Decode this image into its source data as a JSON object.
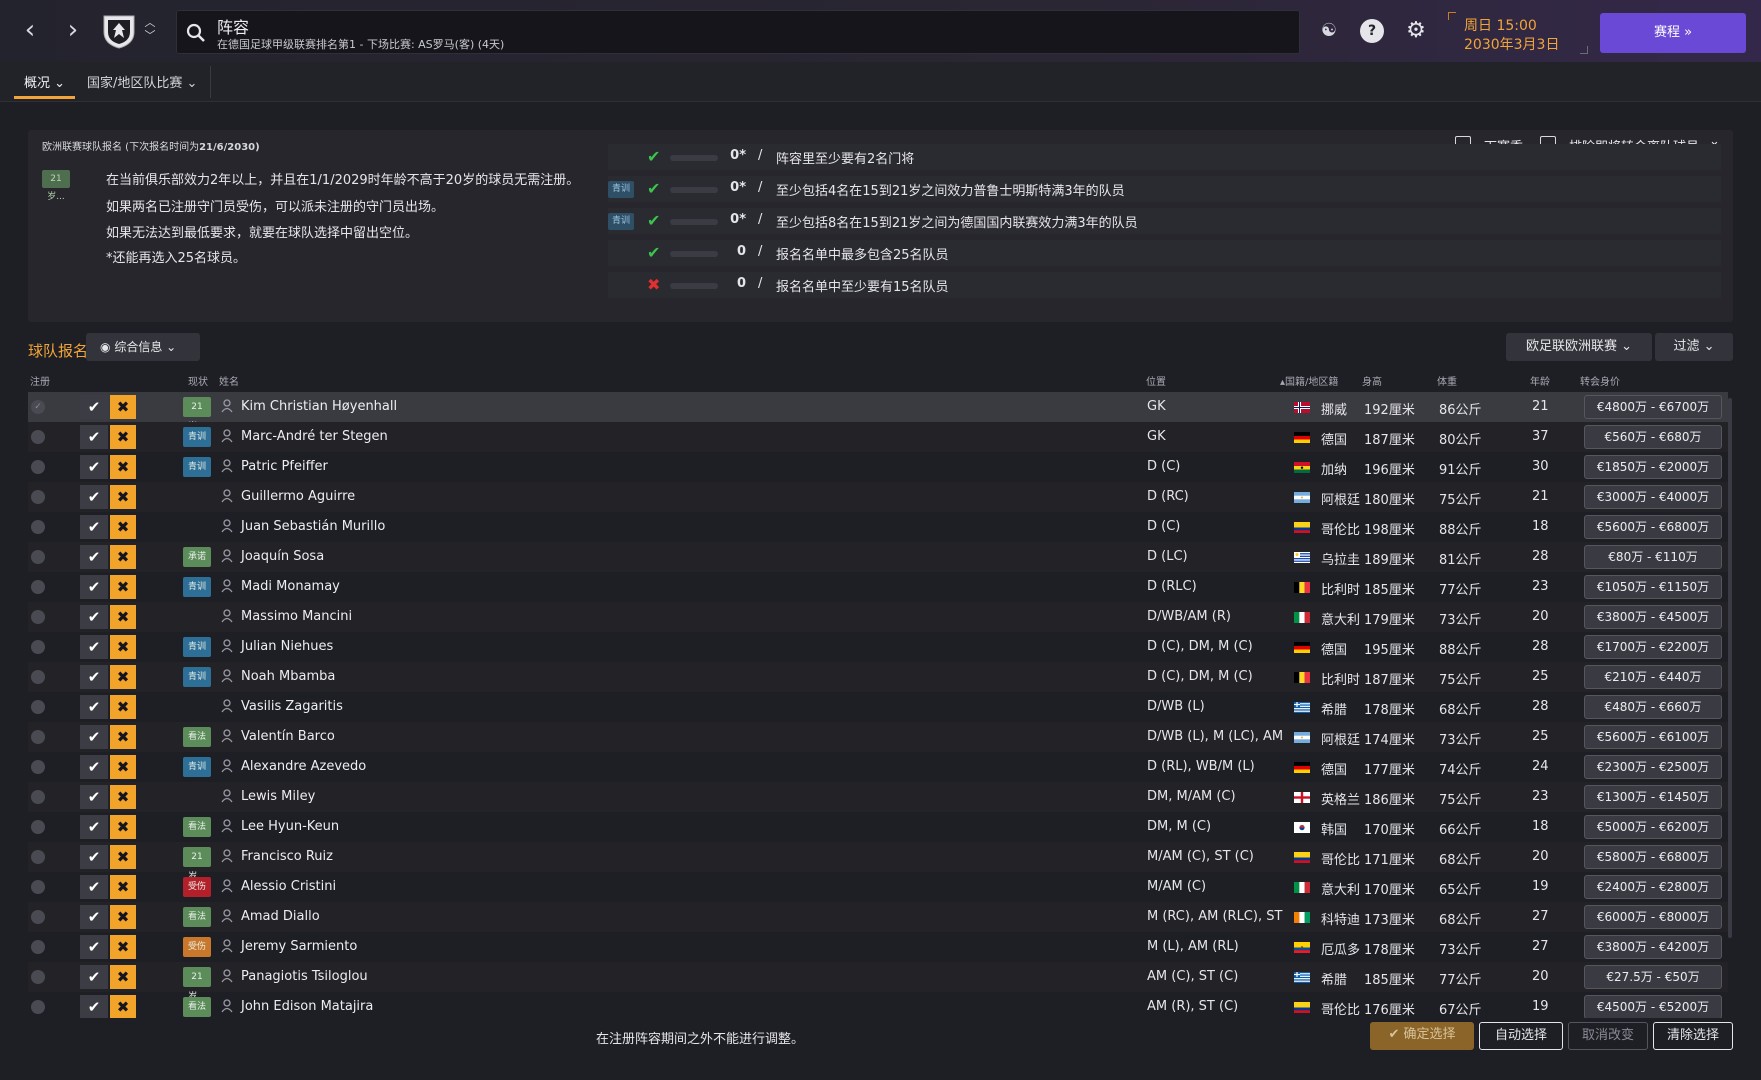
{
  "header": {
    "title": "阵容",
    "subtitle": "在德国足球甲级联赛排名第1 - 下场比赛: AS罗马(客) (4天)",
    "date_line1": "周日 15:00",
    "date_line2": "2030年3月3日",
    "continue_label": "赛程"
  },
  "subnav": {
    "tabs": [
      {
        "label": "概况"
      },
      {
        "label": "国家/地区队比赛"
      }
    ]
  },
  "registration": {
    "heading_prefix": "欧洲联赛球队报名 (下次报名时间为",
    "heading_date": "21/6/2030",
    "heading_suffix": ")",
    "next_season_label": "下赛季",
    "exclude_label": "排除即将转会离队球员",
    "age_badge": "21岁...",
    "rules": [
      "在当前俱乐部效力2年以上，并且在1/1/2029时年龄不高于20岁的球员无需注册。",
      "如果两名已注册守门员受伤，可以派未注册的守门员出场。",
      "如果无法达到最低要求，就要在球队选择中留出空位。",
      "*还能再选入25名球员。"
    ],
    "requirements": [
      {
        "ok": true,
        "badge": "",
        "value": "0*",
        "text": "阵容里至少要有2名门将"
      },
      {
        "ok": true,
        "badge": "青训",
        "value": "0*",
        "text": "至少包括4名在15到21岁之间效力普鲁士明斯特满3年的队员"
      },
      {
        "ok": true,
        "badge": "青训",
        "value": "0*",
        "text": "至少包括8名在15到21岁之间为德国国内联赛效力满3年的队员"
      },
      {
        "ok": true,
        "badge": "",
        "value": "0",
        "text": "报名名单中最多包含25名队员"
      },
      {
        "ok": false,
        "badge": "",
        "value": "0",
        "text": "报名名单中至少要有15名队员"
      }
    ]
  },
  "squad": {
    "section_title": "球队报名",
    "view_label": "综合信息",
    "competition_label": "欧足联欧洲联赛",
    "filter_label": "过滤",
    "columns": {
      "reg": "注册",
      "status": "现状",
      "name": "姓名",
      "position": "位置",
      "nation": "国籍/地区籍",
      "height": "身高",
      "weight": "体重",
      "age": "年龄",
      "value": "转会身价"
    },
    "players": [
      {
        "status": "21岁...",
        "status_color": "#5b8c5a",
        "name": "Kim Christian Høyenhall",
        "position": "GK",
        "flag": "norway",
        "nation": "挪威",
        "height": "192厘米",
        "weight": "86公斤",
        "age": "21",
        "value": "€4800万 - €6700万"
      },
      {
        "status": "青训",
        "status_color": "#2d6f96",
        "name": "Marc-André ter Stegen",
        "position": "GK",
        "flag": "germany",
        "nation": "德国",
        "height": "187厘米",
        "weight": "80公斤",
        "age": "37",
        "value": "€560万 - €680万"
      },
      {
        "status": "青训",
        "status_color": "#2d6f96",
        "name": "Patric Pfeiffer",
        "position": "D (C)",
        "flag": "ghana",
        "nation": "加纳",
        "height": "196厘米",
        "weight": "91公斤",
        "age": "30",
        "value": "€1850万 - €2000万"
      },
      {
        "status": "",
        "status_color": "",
        "name": "Guillermo Aguirre",
        "position": "D (RC)",
        "flag": "argentina",
        "nation": "阿根廷",
        "height": "180厘米",
        "weight": "75公斤",
        "age": "21",
        "value": "€3000万 - €4000万"
      },
      {
        "status": "",
        "status_color": "",
        "name": "Juan Sebastián Murillo",
        "position": "D (C)",
        "flag": "colombia",
        "nation": "哥伦比",
        "height": "198厘米",
        "weight": "88公斤",
        "age": "18",
        "value": "€5600万 - €6800万"
      },
      {
        "status": "承诺",
        "status_color": "#5b8c5a",
        "name": "Joaquín Sosa",
        "position": "D (LC)",
        "flag": "uruguay",
        "nation": "乌拉圭",
        "height": "189厘米",
        "weight": "81公斤",
        "age": "28",
        "value": "€80万 - €110万"
      },
      {
        "status": "青训",
        "status_color": "#2d6f96",
        "name": "Madi Monamay",
        "position": "D (RLC)",
        "flag": "belgium",
        "nation": "比利时",
        "height": "185厘米",
        "weight": "77公斤",
        "age": "23",
        "value": "€1050万 - €1150万"
      },
      {
        "status": "",
        "status_color": "",
        "name": "Massimo Mancini",
        "position": "D/WB/AM (R)",
        "flag": "italy",
        "nation": "意大利",
        "height": "179厘米",
        "weight": "73公斤",
        "age": "20",
        "value": "€3800万 - €4500万"
      },
      {
        "status": "青训",
        "status_color": "#2d6f96",
        "name": "Julian Niehues",
        "position": "D (C), DM, M (C)",
        "flag": "germany",
        "nation": "德国",
        "height": "195厘米",
        "weight": "88公斤",
        "age": "28",
        "value": "€1700万 - €2200万"
      },
      {
        "status": "青训",
        "status_color": "#2d6f96",
        "name": "Noah Mbamba",
        "position": "D (C), DM, M (C)",
        "flag": "belgium",
        "nation": "比利时",
        "height": "187厘米",
        "weight": "75公斤",
        "age": "25",
        "value": "€210万 - €440万"
      },
      {
        "status": "",
        "status_color": "",
        "name": "Vasilis Zagaritis",
        "position": "D/WB (L)",
        "flag": "greece",
        "nation": "希腊",
        "height": "178厘米",
        "weight": "68公斤",
        "age": "28",
        "value": "€480万 - €660万"
      },
      {
        "status": "看法",
        "status_color": "#5b8c5a",
        "name": "Valentín Barco",
        "position": "D/WB (L), M (LC), AM (...",
        "flag": "argentina",
        "nation": "阿根廷",
        "height": "174厘米",
        "weight": "73公斤",
        "age": "25",
        "value": "€5600万 - €6100万"
      },
      {
        "status": "青训",
        "status_color": "#2d6f96",
        "name": "Alexandre Azevedo",
        "position": "D (RL), WB/M (L)",
        "flag": "germany",
        "nation": "德国",
        "height": "177厘米",
        "weight": "74公斤",
        "age": "24",
        "value": "€2300万 - €2500万"
      },
      {
        "status": "",
        "status_color": "",
        "name": "Lewis Miley",
        "position": "DM, M/AM (C)",
        "flag": "england",
        "nation": "英格兰",
        "height": "186厘米",
        "weight": "75公斤",
        "age": "23",
        "value": "€1300万 - €1450万"
      },
      {
        "status": "看法",
        "status_color": "#5b8c5a",
        "name": "Lee Hyun-Keun",
        "position": "DM, M (C)",
        "flag": "korea",
        "nation": "韩国",
        "height": "170厘米",
        "weight": "66公斤",
        "age": "18",
        "value": "€5000万 - €6200万"
      },
      {
        "status": "21岁...",
        "status_color": "#5b8c5a",
        "name": "Francisco Ruiz",
        "position": "M/AM (C), ST (C)",
        "flag": "colombia",
        "nation": "哥伦比",
        "height": "171厘米",
        "weight": "68公斤",
        "age": "20",
        "value": "€5800万 - €6800万"
      },
      {
        "status": "受伤",
        "status_color": "#b3202a",
        "name": "Alessio Cristini",
        "position": "M/AM (C)",
        "flag": "italy",
        "nation": "意大利",
        "height": "170厘米",
        "weight": "65公斤",
        "age": "19",
        "value": "€2400万 - €2800万"
      },
      {
        "status": "看法",
        "status_color": "#5b8c5a",
        "name": "Amad Diallo",
        "position": "M (RC), AM (RLC), ST (...",
        "flag": "ivorycoast",
        "nation": "科特迪",
        "height": "173厘米",
        "weight": "68公斤",
        "age": "27",
        "value": "€6000万 - €8000万"
      },
      {
        "status": "受伤",
        "status_color": "#c9772a",
        "name": "Jeremy Sarmiento",
        "position": "M (L), AM (RL)",
        "flag": "ecuador",
        "nation": "厄瓜多",
        "height": "178厘米",
        "weight": "73公斤",
        "age": "27",
        "value": "€3800万 - €4200万"
      },
      {
        "status": "21岁...",
        "status_color": "#5b8c5a",
        "name": "Panagiotis Tsiloglou",
        "position": "AM (C), ST (C)",
        "flag": "greece",
        "nation": "希腊",
        "height": "185厘米",
        "weight": "77公斤",
        "age": "20",
        "value": "€27.5万 - €50万"
      },
      {
        "status": "看法",
        "status_color": "#5b8c5a",
        "name": "John Edison Matajira",
        "position": "AM (R), ST (C)",
        "flag": "colombia",
        "nation": "哥伦比",
        "height": "176厘米",
        "weight": "67公斤",
        "age": "19",
        "value": "€4500万 - €5200万"
      }
    ]
  },
  "footer": {
    "notice": "在注册阵容期间之外不能进行调整。",
    "confirm_label": "确定选择",
    "auto_label": "自动选择",
    "cancel_label": "取消改变",
    "clear_label": "清除选择"
  },
  "colors": {
    "accent": "#f2a43a",
    "primary_button": "#6a49d6",
    "ok": "#3cc24a",
    "fail": "#e03030"
  }
}
